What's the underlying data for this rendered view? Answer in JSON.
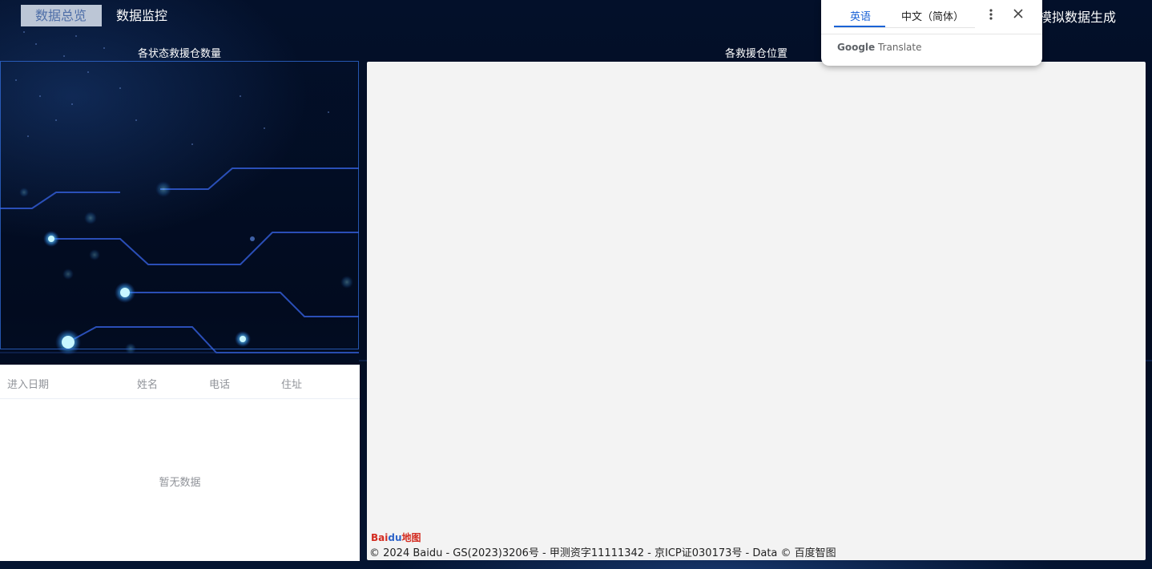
{
  "nav": {
    "tabs": [
      {
        "label": "数据总览",
        "active": true
      },
      {
        "label": "数据监控",
        "active": false
      }
    ],
    "right_link": "模拟数据生成"
  },
  "left_panel": {
    "chart_title": "各状态救援仓数量"
  },
  "table": {
    "columns": [
      "进入日期",
      "姓名",
      "电话",
      "住址"
    ],
    "empty_text": "暂无数据"
  },
  "map": {
    "title": "各救援仓位置",
    "logo": {
      "part1": "Bai",
      "part2": "du",
      "part3": "地图"
    },
    "copyright": "© 2024 Baidu - GS(2023)3206号 - 甲测资字11111342 - 京ICP证030173号 - Data © 百度智图"
  },
  "translate_popup": {
    "tabs": [
      {
        "label": "英语",
        "active": true
      },
      {
        "label": "中文（简体）",
        "active": false
      }
    ],
    "menu_icon": "more-vert-icon",
    "close_icon": "close-icon",
    "brand_google": "Google",
    "brand_translate": "Translate"
  },
  "colors": {
    "background": "#020a1c",
    "active_tab_bg": "#bcc6d6",
    "active_tab_text": "#4f6fa8",
    "chart_border": "#326edc",
    "map_bg": "#f3f3f3",
    "accent_blue": "#1a62d6"
  }
}
